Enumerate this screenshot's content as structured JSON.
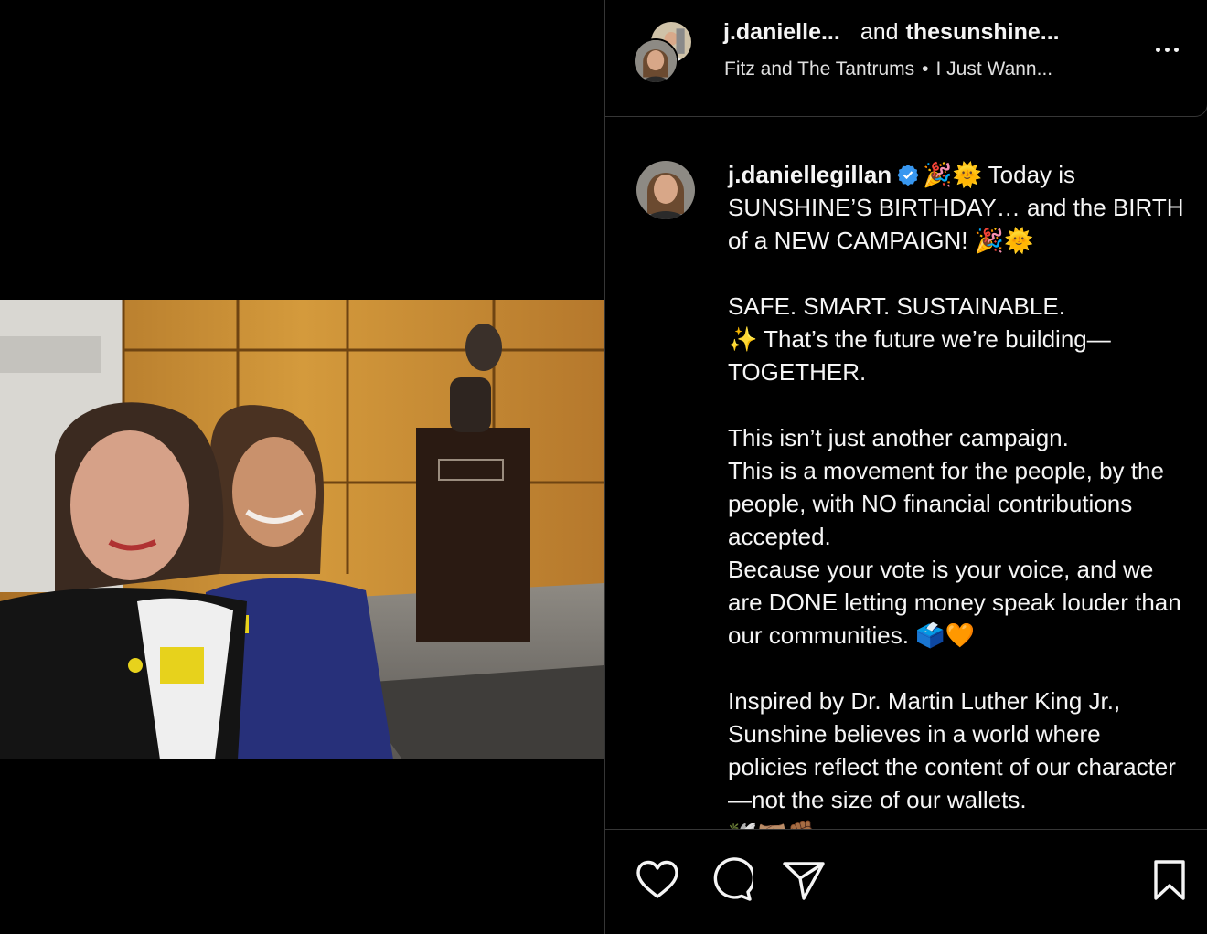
{
  "header": {
    "user1": "j.danielle...",
    "connector": "and",
    "user2": "thesunshine...",
    "audio_artist": "Fitz and The Tantrums",
    "audio_separator": "•",
    "audio_title": "I Just Wann..."
  },
  "caption": {
    "username": "j.daniellegillan",
    "paragraphs": [
      "🎉🌞 Today is SUNSHINE’S BIRTHDAY… and the BIRTH of a NEW CAMPAIGN! 🎉🌞",
      "SAFE. SMART. SUSTAINABLE.",
      "✨ That’s the future we’re building—TOGETHER.",
      "This isn’t just another campaign.",
      "This is a movement for the people, by the people, with NO financial contributions accepted.",
      "Because your vote is your voice, and we are DONE letting money speak louder than our communities. 🗳️🧡",
      "Inspired by Dr. Martin Luther King Jr., Sunshine believes in a world where policies reflect the content of our character—not the size of our wallets.",
      "🕊️🤝🏽✊🏾"
    ]
  },
  "icons": {
    "more": "more-options-icon",
    "like": "heart-icon",
    "comment": "comment-icon",
    "share": "paper-plane-icon",
    "save": "bookmark-icon",
    "verified": "verified-badge-icon"
  },
  "colors": {
    "background": "#000000",
    "text": "#f5f5f5",
    "divider": "#363636",
    "verified": "#3897f0"
  }
}
